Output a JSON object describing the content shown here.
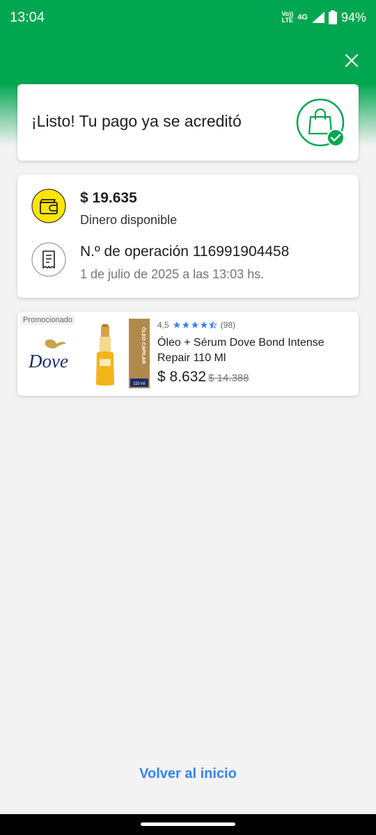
{
  "status_bar": {
    "time": "13:04",
    "network_top": "Vo))",
    "network_bottom": "LTE",
    "network_type": "4G",
    "battery": "94%"
  },
  "success": {
    "title": "¡Listo! Tu pago ya se acreditó",
    "icon": "shopping-bag-check-icon"
  },
  "details": {
    "amount": "$ 19.635",
    "amount_label": "Dinero disponible",
    "operation_label": "N.º de operación 116991904458",
    "operation_date": "1 de julio de 2025 a las 13:03 hs."
  },
  "promo": {
    "badge": "Promocionado",
    "brand": "Dove",
    "rating": "4,5",
    "rating_value": 4.5,
    "reviews": "(98)",
    "title": "Óleo + Sérum  Dove  Bond Intense Repair 110 Ml",
    "price": "$ 8.632",
    "old_price": "$ 14.388",
    "box_label": "ÓLEO CAPILAR",
    "box_size": "110 ml"
  },
  "footer": {
    "home_link": "Volver al inicio"
  },
  "colors": {
    "brand_green": "#00a650",
    "link_blue": "#3483fa",
    "star_blue": "#3483fa",
    "wallet_yellow": "#ffe600"
  }
}
